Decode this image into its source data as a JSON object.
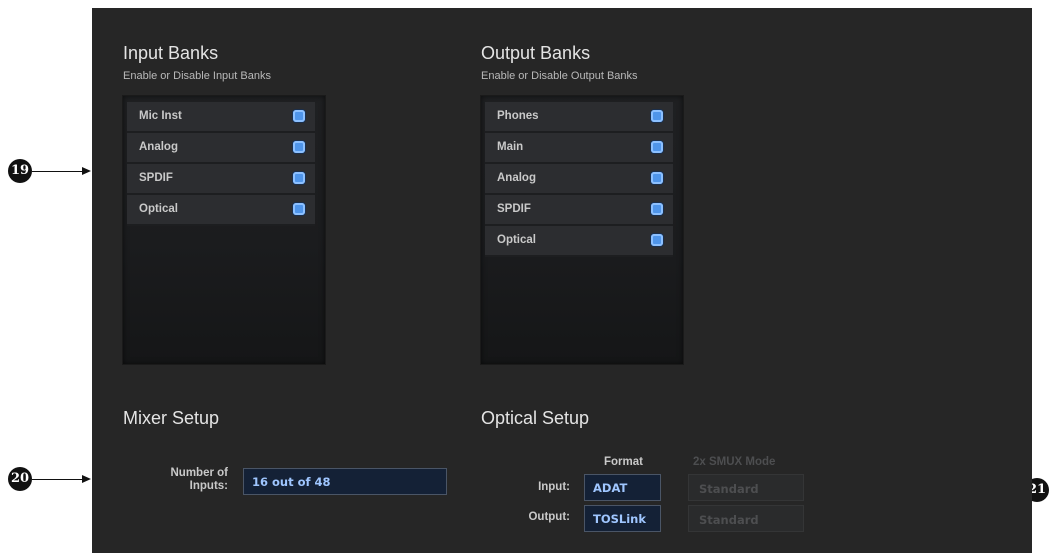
{
  "callouts": [
    "19",
    "20",
    "21"
  ],
  "input_banks": {
    "title": "Input Banks",
    "subtitle": "Enable or Disable Input Banks",
    "items": [
      {
        "label": "Mic Inst",
        "enabled": true
      },
      {
        "label": "Analog",
        "enabled": true
      },
      {
        "label": "SPDIF",
        "enabled": true
      },
      {
        "label": "Optical",
        "enabled": true
      }
    ]
  },
  "output_banks": {
    "title": "Output Banks",
    "subtitle": "Enable or Disable Output Banks",
    "items": [
      {
        "label": "Phones",
        "enabled": true
      },
      {
        "label": "Main",
        "enabled": true
      },
      {
        "label": "Analog",
        "enabled": true
      },
      {
        "label": "SPDIF",
        "enabled": true
      },
      {
        "label": "Optical",
        "enabled": true
      }
    ]
  },
  "mixer_setup": {
    "title": "Mixer Setup",
    "number_of_inputs_label_line1": "Number of",
    "number_of_inputs_label_line2": "Inputs:",
    "number_of_inputs_value": "16 out of 48"
  },
  "optical_setup": {
    "title": "Optical Setup",
    "format_header": "Format",
    "smux_header": "2x SMUX Mode",
    "input_label": "Input:",
    "output_label": "Output:",
    "input_format": "ADAT",
    "output_format": "TOSLink",
    "input_smux": "Standard",
    "output_smux": "Standard"
  },
  "colors": {
    "panel_bg": "#262626",
    "checkbox_blue": "#4f95ea",
    "value_text": "#9fc6ff"
  }
}
